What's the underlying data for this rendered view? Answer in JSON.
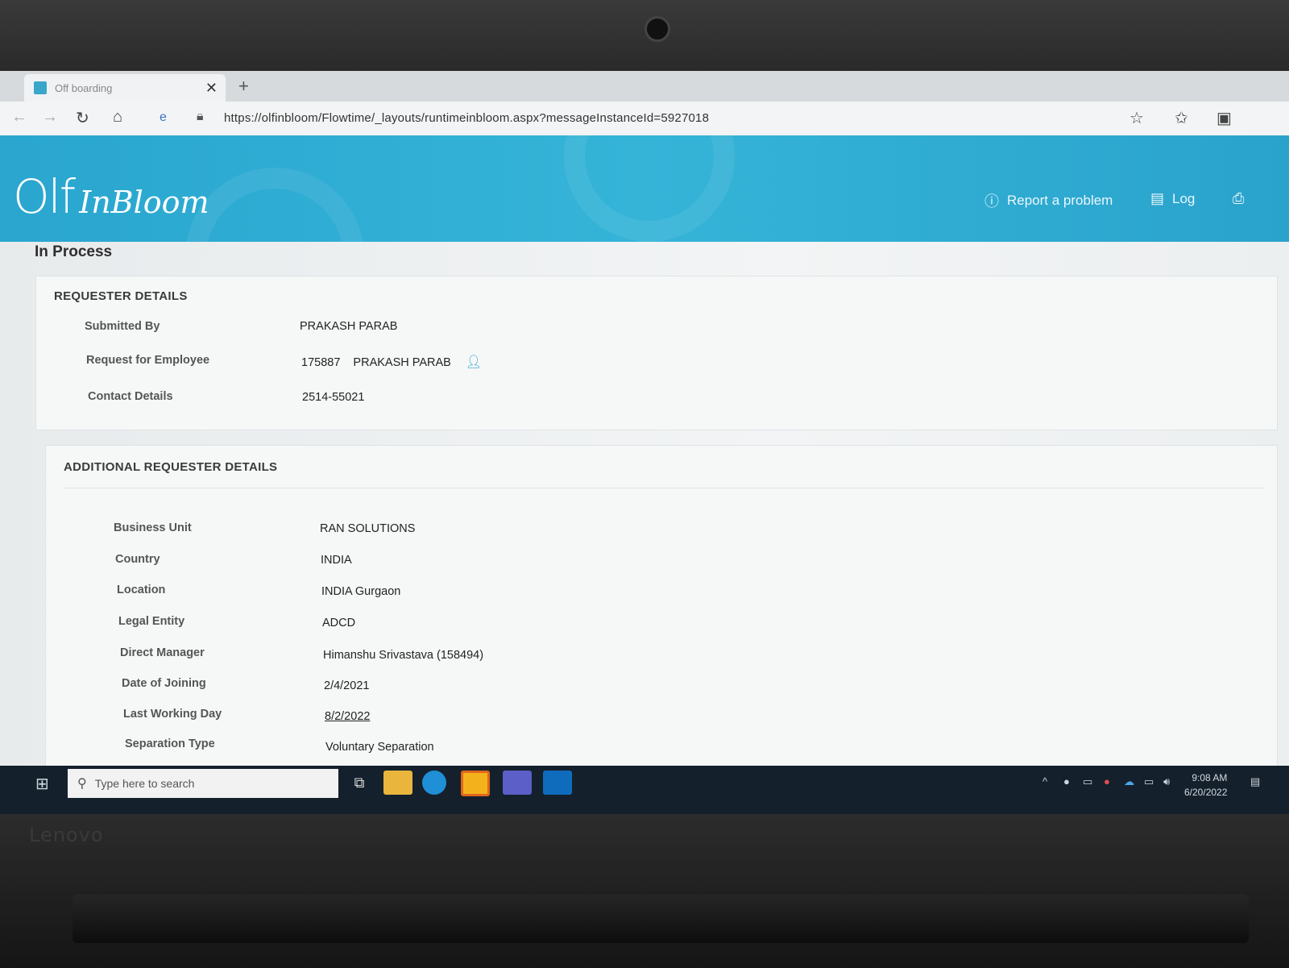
{
  "browser": {
    "tab_title": "Off boarding",
    "url": "https://olfinbloom/Flowtime/_layouts/runtimeinbloom.aspx?messageInstanceId=5927018"
  },
  "header": {
    "logo_main": "Olf",
    "logo_script": "InBloom",
    "report_problem": "Report a problem",
    "log": "Log"
  },
  "page": {
    "status_title": "In Process"
  },
  "requester": {
    "heading": "REQUESTER DETAILS",
    "submitted_by_label": "Submitted By",
    "submitted_by": "PRAKASH PARAB",
    "request_for_label": "Request for Employee",
    "employee_id": "175887",
    "employee_name": "PRAKASH PARAB",
    "contact_label": "Contact Details",
    "contact": "2514-55021"
  },
  "additional": {
    "heading": "ADDITIONAL REQUESTER DETAILS",
    "business_unit_label": "Business Unit",
    "business_unit": "RAN SOLUTIONS",
    "country_label": "Country",
    "country": "INDIA",
    "location_label": "Location",
    "location": "INDIA Gurgaon",
    "legal_entity_label": "Legal Entity",
    "legal_entity": "ADCD",
    "manager_label": "Direct Manager",
    "manager": "Himanshu Srivastava (158494)",
    "doj_label": "Date of Joining",
    "doj": "2/4/2021",
    "lwd_label": "Last Working Day",
    "lwd": "8/2/2022",
    "sep_type_label": "Separation Type",
    "sep_type": "Voluntary Separation"
  },
  "taskbar": {
    "search_placeholder": "Type here to search",
    "time": "9:08 AM",
    "date": "6/20/2022"
  },
  "device": {
    "brand": "Lenovo"
  }
}
